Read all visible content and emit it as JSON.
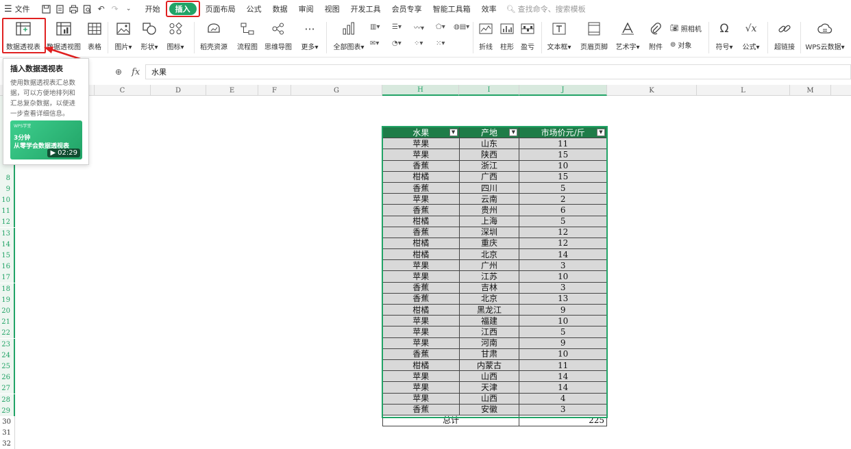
{
  "menu": {
    "file": "文件",
    "tabs": [
      "开始",
      "插入",
      "页面布局",
      "公式",
      "数据",
      "审阅",
      "视图",
      "开发工具",
      "会员专享",
      "智能工具箱",
      "效率"
    ],
    "active_tab": "插入",
    "search_placeholder": "查找命令、搜索模板"
  },
  "ribbon": {
    "pivot_table": "数据透视表",
    "pivot_chart": "数据透视图",
    "table": "表格",
    "picture": "图片",
    "shape": "形状",
    "icon": "图标",
    "docer": "稻壳资源",
    "flowchart": "流程图",
    "mindmap": "思维导图",
    "more": "更多",
    "all_charts": "全部图表",
    "line": "折线",
    "column": "柱形",
    "winloss": "盈亏",
    "textbox": "文本框",
    "header_footer": "页眉页脚",
    "wordart": "艺术字",
    "attachment": "附件",
    "camera": "照相机",
    "object": "对象",
    "symbol": "符号",
    "formula": "公式",
    "hyperlink": "超链接",
    "wps_cloud": "WPS云数据"
  },
  "formula_bar": {
    "fx": "fx",
    "value": "水果"
  },
  "columns": [
    "C",
    "D",
    "E",
    "F",
    "G",
    "H",
    "I",
    "J",
    "K",
    "L",
    "M"
  ],
  "rows": [
    "8",
    "9",
    "10",
    "11",
    "12",
    "13",
    "14",
    "15",
    "16",
    "17",
    "18",
    "19",
    "20",
    "21",
    "22",
    "23",
    "24",
    "25",
    "26",
    "27",
    "28",
    "29",
    "30",
    "31",
    "32"
  ],
  "tooltip": {
    "title": "插入数据透视表",
    "desc": "使用数据透视表汇总数据，可以方便地排列和汇总复杂数据，以便进一步查看详细信息。",
    "card_brand": "WPS学堂",
    "card_line1": "3分钟",
    "card_line2": "从零学会数据透视表",
    "card_duration": "02:29"
  },
  "table": {
    "headers": [
      "水果",
      "产地",
      "市场价元/斤"
    ],
    "rows": [
      [
        "苹果",
        "山东",
        "11"
      ],
      [
        "苹果",
        "陕西",
        "15"
      ],
      [
        "香蕉",
        "浙江",
        "10"
      ],
      [
        "柑橘",
        "广西",
        "15"
      ],
      [
        "香蕉",
        "四川",
        "5"
      ],
      [
        "苹果",
        "云南",
        "2"
      ],
      [
        "香蕉",
        "贵州",
        "6"
      ],
      [
        "柑橘",
        "上海",
        "5"
      ],
      [
        "香蕉",
        "深圳",
        "12"
      ],
      [
        "柑橘",
        "重庆",
        "12"
      ],
      [
        "柑橘",
        "北京",
        "14"
      ],
      [
        "苹果",
        "广州",
        "3"
      ],
      [
        "苹果",
        "江苏",
        "10"
      ],
      [
        "香蕉",
        "吉林",
        "3"
      ],
      [
        "香蕉",
        "北京",
        "13"
      ],
      [
        "柑橘",
        "黑龙江",
        "9"
      ],
      [
        "苹果",
        "福建",
        "10"
      ],
      [
        "苹果",
        "江西",
        "5"
      ],
      [
        "苹果",
        "河南",
        "9"
      ],
      [
        "香蕉",
        "甘肃",
        "10"
      ],
      [
        "柑橘",
        "内蒙古",
        "11"
      ],
      [
        "苹果",
        "山西",
        "14"
      ],
      [
        "苹果",
        "天津",
        "14"
      ],
      [
        "苹果",
        "山西",
        "4"
      ],
      [
        "香蕉",
        "安徽",
        "3"
      ]
    ],
    "total_label": "总计",
    "total_value": "225"
  }
}
